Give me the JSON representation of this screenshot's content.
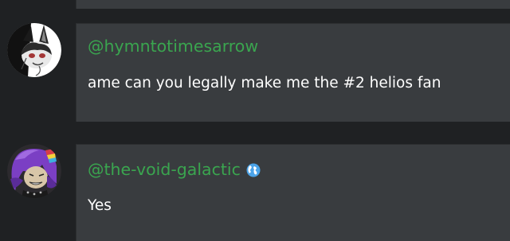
{
  "posts": [
    {
      "username": "@hymntotimesarrow",
      "message": "ame can you legally make me the #2 helios fan",
      "avatar_icon": "wolf-avatar"
    },
    {
      "username": "@the-void-galactic",
      "username_badge_icon": "globe-icon",
      "message": "Yes",
      "avatar_icon": "purple-hair-character-avatar"
    }
  ],
  "colors": {
    "background": "#1f2123",
    "card": "#393c3f",
    "username": "#3aa54f",
    "message": "#ffffff",
    "globe": "#4ba3e8"
  }
}
